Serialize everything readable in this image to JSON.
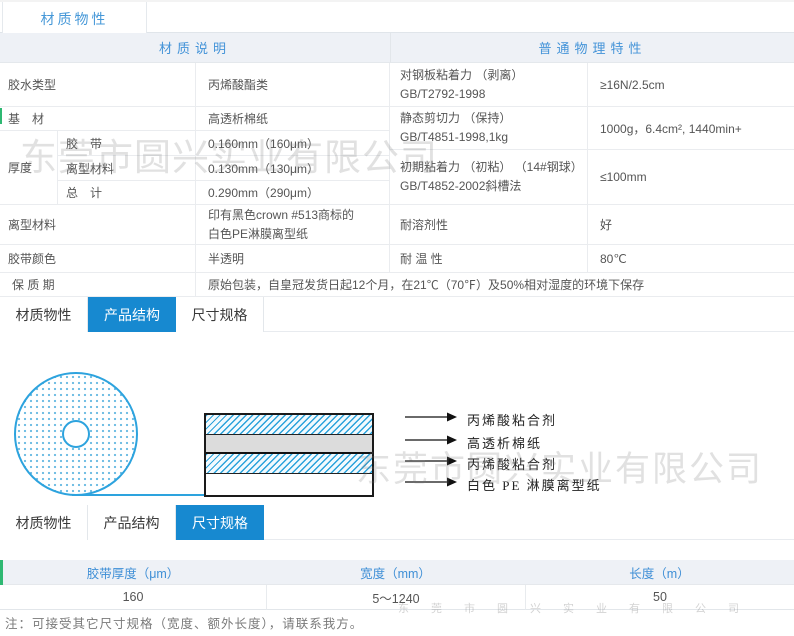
{
  "app": {
    "title_tab": "材质物性"
  },
  "material_table": {
    "header_left": "材质说明",
    "header_right": "普通物理特性",
    "rows_left": {
      "glue_type": {
        "label": "胶水类型",
        "value": "丙烯酸酯类"
      },
      "base_material": {
        "label": "基　材",
        "value": "高透析棉纸"
      },
      "thickness": {
        "label": "厚度",
        "sub_rows": [
          {
            "label": "胶　带",
            "value": "0.160mm（160μm）"
          },
          {
            "label": "离型材料",
            "value": "0.130mm（130μm）"
          },
          {
            "label": "总　计",
            "value": "0.290mm（290μm）"
          }
        ]
      },
      "release_liner": {
        "label": "离型材料",
        "value_line1": "印有黑色crown #513商标的",
        "value_line2": "白色PE淋膜离型纸"
      },
      "tape_color": {
        "label": "胶带颜色",
        "value": "半透明"
      },
      "shelf_life": {
        "label": "保 质 期",
        "value": "原始包装，自皇冠发货日起12个月，在21℃（70℉）及50%相对湿度的环境下保存"
      }
    },
    "rows_right": {
      "peel_adhesion": {
        "label_line1": "对钢板粘着力 （剥离）",
        "label_line2": "GB/T2792-1998",
        "value": "≥16N/2.5cm"
      },
      "static_shear": {
        "label_line1": "静态剪切力 （保持）",
        "label_line2": "GB/T4851-1998,1kg",
        "value": "1000g，6.4cm², 1440min+"
      },
      "initial_tack": {
        "label_line1": "初期粘着力 （初粘） （14#钢球）",
        "label_line2": "GB/T4852-2002斜槽法",
        "value": "≤100mm"
      },
      "solvent_resistance": {
        "label": "耐溶剂性",
        "value": "好"
      },
      "temperature_resistance": {
        "label": "耐 温 性",
        "value": "80℃"
      }
    }
  },
  "tab_bars": {
    "structure_bar": {
      "tabs": [
        "材质物性",
        "产品结构",
        "尺寸规格"
      ],
      "active": "产品结构"
    },
    "size_bar": {
      "tabs": [
        "材质物性",
        "产品结构",
        "尺寸规格"
      ],
      "active": "尺寸规格"
    }
  },
  "diagram": {
    "layer_labels": [
      "丙烯酸粘合剂",
      "高透析棉纸",
      "丙烯酸粘合剂",
      "白色 PE 淋膜离型纸"
    ]
  },
  "size_table": {
    "headers": [
      "胶带厚度（μm）",
      "宽度（mm）",
      "长度（m）"
    ],
    "values": [
      "160",
      "5～1240",
      "50"
    ]
  },
  "note": "注：可接受其它尺寸规格（宽度、额外长度），请联系我方。",
  "watermark": {
    "text": "东莞市圆兴实业有限公司"
  },
  "colors": {
    "accent_blue": "#1789d0",
    "header_text_blue": "#4393d8",
    "header_bg": "#eef1f6",
    "diagram_blue": "#2aa2db",
    "green_mark": "#2eb872"
  }
}
